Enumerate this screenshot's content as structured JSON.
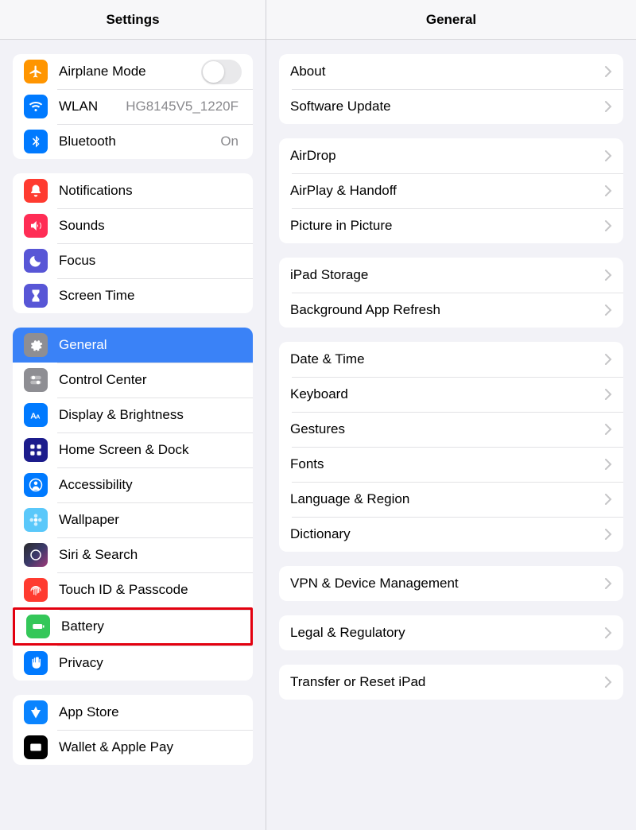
{
  "sidebar": {
    "title": "Settings",
    "groups": [
      [
        {
          "id": "airplane",
          "label": "Airplane Mode",
          "icon": "airplane",
          "bg": "bg-orange",
          "control": "toggle",
          "toggle": false
        },
        {
          "id": "wlan",
          "label": "WLAN",
          "icon": "wifi",
          "bg": "bg-blue",
          "secondary": "HG8145V5_1220F"
        },
        {
          "id": "bluetooth",
          "label": "Bluetooth",
          "icon": "bluetooth",
          "bg": "bg-blue",
          "secondary": "On"
        }
      ],
      [
        {
          "id": "notifications",
          "label": "Notifications",
          "icon": "bell",
          "bg": "bg-red"
        },
        {
          "id": "sounds",
          "label": "Sounds",
          "icon": "speaker",
          "bg": "bg-redpink"
        },
        {
          "id": "focus",
          "label": "Focus",
          "icon": "moon",
          "bg": "bg-indigo"
        },
        {
          "id": "screentime",
          "label": "Screen Time",
          "icon": "hourglass",
          "bg": "bg-indigo"
        }
      ],
      [
        {
          "id": "general",
          "label": "General",
          "icon": "gear",
          "bg": "bg-gray",
          "selected": true
        },
        {
          "id": "controlcenter",
          "label": "Control Center",
          "icon": "switches",
          "bg": "bg-gray"
        },
        {
          "id": "display",
          "label": "Display & Brightness",
          "icon": "textsize",
          "bg": "bg-blue"
        },
        {
          "id": "homescreen",
          "label": "Home Screen & Dock",
          "icon": "grid",
          "bg": "bg-darkblue"
        },
        {
          "id": "accessibility",
          "label": "Accessibility",
          "icon": "person",
          "bg": "bg-blue"
        },
        {
          "id": "wallpaper",
          "label": "Wallpaper",
          "icon": "flower",
          "bg": "bg-paleblue"
        },
        {
          "id": "siri",
          "label": "Siri & Search",
          "icon": "siri",
          "bg": "bg-siri"
        },
        {
          "id": "touchid",
          "label": "Touch ID & Passcode",
          "icon": "fingerprint",
          "bg": "bg-red"
        },
        {
          "id": "battery",
          "label": "Battery",
          "icon": "battery",
          "bg": "bg-green",
          "highlight": true
        },
        {
          "id": "privacy",
          "label": "Privacy",
          "icon": "hand",
          "bg": "bg-blue"
        }
      ],
      [
        {
          "id": "appstore",
          "label": "App Store",
          "icon": "appstore",
          "bg": "bg-bluealt"
        },
        {
          "id": "wallet",
          "label": "Wallet & Apple Pay",
          "icon": "wallet",
          "bg": "bg-black"
        }
      ]
    ]
  },
  "detail": {
    "title": "General",
    "groups": [
      [
        {
          "id": "about",
          "label": "About"
        },
        {
          "id": "software-update",
          "label": "Software Update"
        }
      ],
      [
        {
          "id": "airdrop",
          "label": "AirDrop"
        },
        {
          "id": "airplay",
          "label": "AirPlay & Handoff"
        },
        {
          "id": "pip",
          "label": "Picture in Picture"
        }
      ],
      [
        {
          "id": "ipadstorage",
          "label": "iPad Storage"
        },
        {
          "id": "bgrefresh",
          "label": "Background App Refresh"
        }
      ],
      [
        {
          "id": "datetime",
          "label": "Date & Time"
        },
        {
          "id": "keyboard",
          "label": "Keyboard"
        },
        {
          "id": "gestures",
          "label": "Gestures"
        },
        {
          "id": "fonts",
          "label": "Fonts"
        },
        {
          "id": "language",
          "label": "Language & Region"
        },
        {
          "id": "dictionary",
          "label": "Dictionary"
        }
      ],
      [
        {
          "id": "vpn",
          "label": "VPN & Device Management"
        }
      ],
      [
        {
          "id": "legal",
          "label": "Legal & Regulatory"
        }
      ],
      [
        {
          "id": "transfer",
          "label": "Transfer or Reset iPad"
        }
      ]
    ]
  }
}
